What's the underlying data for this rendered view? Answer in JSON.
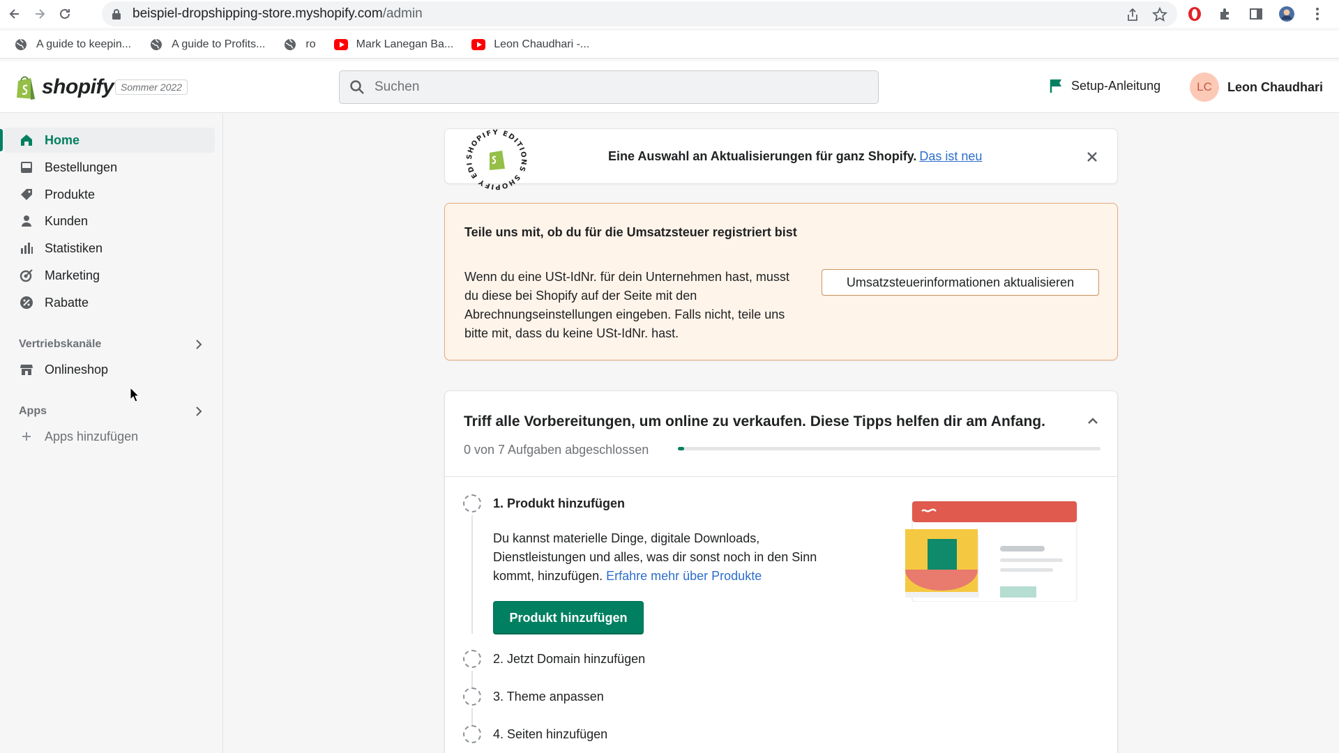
{
  "browser": {
    "url_host": "beispiel-dropshipping-store.myshopify.com",
    "url_path": "/admin",
    "bookmarks": [
      {
        "label": "A guide to keepin...",
        "icon": "globe-icon"
      },
      {
        "label": "A guide to Profits...",
        "icon": "globe-icon"
      },
      {
        "label": "ro",
        "icon": "globe-icon"
      },
      {
        "label": "Mark Lanegan Ba...",
        "icon": "youtube-icon"
      },
      {
        "label": "Leon Chaudhari -...",
        "icon": "youtube-icon"
      }
    ]
  },
  "topbar": {
    "logo_text": "shopify",
    "edition": "Sommer 2022",
    "search_placeholder": "Suchen",
    "setup_label": "Setup-Anleitung",
    "user_initials": "LC",
    "user_name": "Leon Chaudhari"
  },
  "sidebar": {
    "items": [
      {
        "label": "Home",
        "icon": "home-icon"
      },
      {
        "label": "Bestellungen",
        "icon": "inbox-icon"
      },
      {
        "label": "Produkte",
        "icon": "tag-icon"
      },
      {
        "label": "Kunden",
        "icon": "person-icon"
      },
      {
        "label": "Statistiken",
        "icon": "bar-chart-icon"
      },
      {
        "label": "Marketing",
        "icon": "target-icon"
      },
      {
        "label": "Rabatte",
        "icon": "discount-icon"
      }
    ],
    "sales_channels_label": "Vertriebskanäle",
    "onlineshop_label": "Onlineshop",
    "apps_label": "Apps",
    "apps_add_label": "Apps hinzufügen"
  },
  "banner": {
    "text": "Eine Auswahl an Aktualisierungen für ganz Shopify.",
    "link": "Das ist neu",
    "badge_text": "SHOPIFY EDITIONS SHOPIFY EDITIONS"
  },
  "tax": {
    "title": "Teile uns mit, ob du für die Umsatzsteuer registriert bist",
    "body": "Wenn du eine USt-IdNr. für dein Unternehmen hast, musst du diese bei Shopify auf der Seite mit den Abrechnungseinstellungen eingeben. Falls nicht, teile uns bitte mit, dass du keine USt-IdNr. hast.",
    "button": "Umsatzsteuerinformationen aktualisieren"
  },
  "tips": {
    "title": "Triff alle Vorbereitungen, um online zu verkaufen. Diese Tipps helfen dir am Anfang.",
    "progress_text": "0 von 7 Aufgaben abgeschlossen",
    "progress_fraction": 0.015,
    "steps": [
      {
        "label": "1. Produkt hinzufügen"
      },
      {
        "label": "2. Jetzt Domain hinzufügen"
      },
      {
        "label": "3. Theme anpassen"
      },
      {
        "label": "4. Seiten hinzufügen"
      }
    ],
    "step1_desc": "Du kannst materielle Dinge, digitale Downloads, Dienstleistungen und alles, was dir sonst noch in den Sinn kommt, hinzufügen.",
    "step1_link": "Erfahre mehr über Produkte",
    "step1_button": "Produkt hinzufügen"
  },
  "colors": {
    "brand_green": "#008060",
    "link_blue": "#2c6ecb",
    "warning_bg": "#fff4ea",
    "warning_border": "#e8a876"
  }
}
